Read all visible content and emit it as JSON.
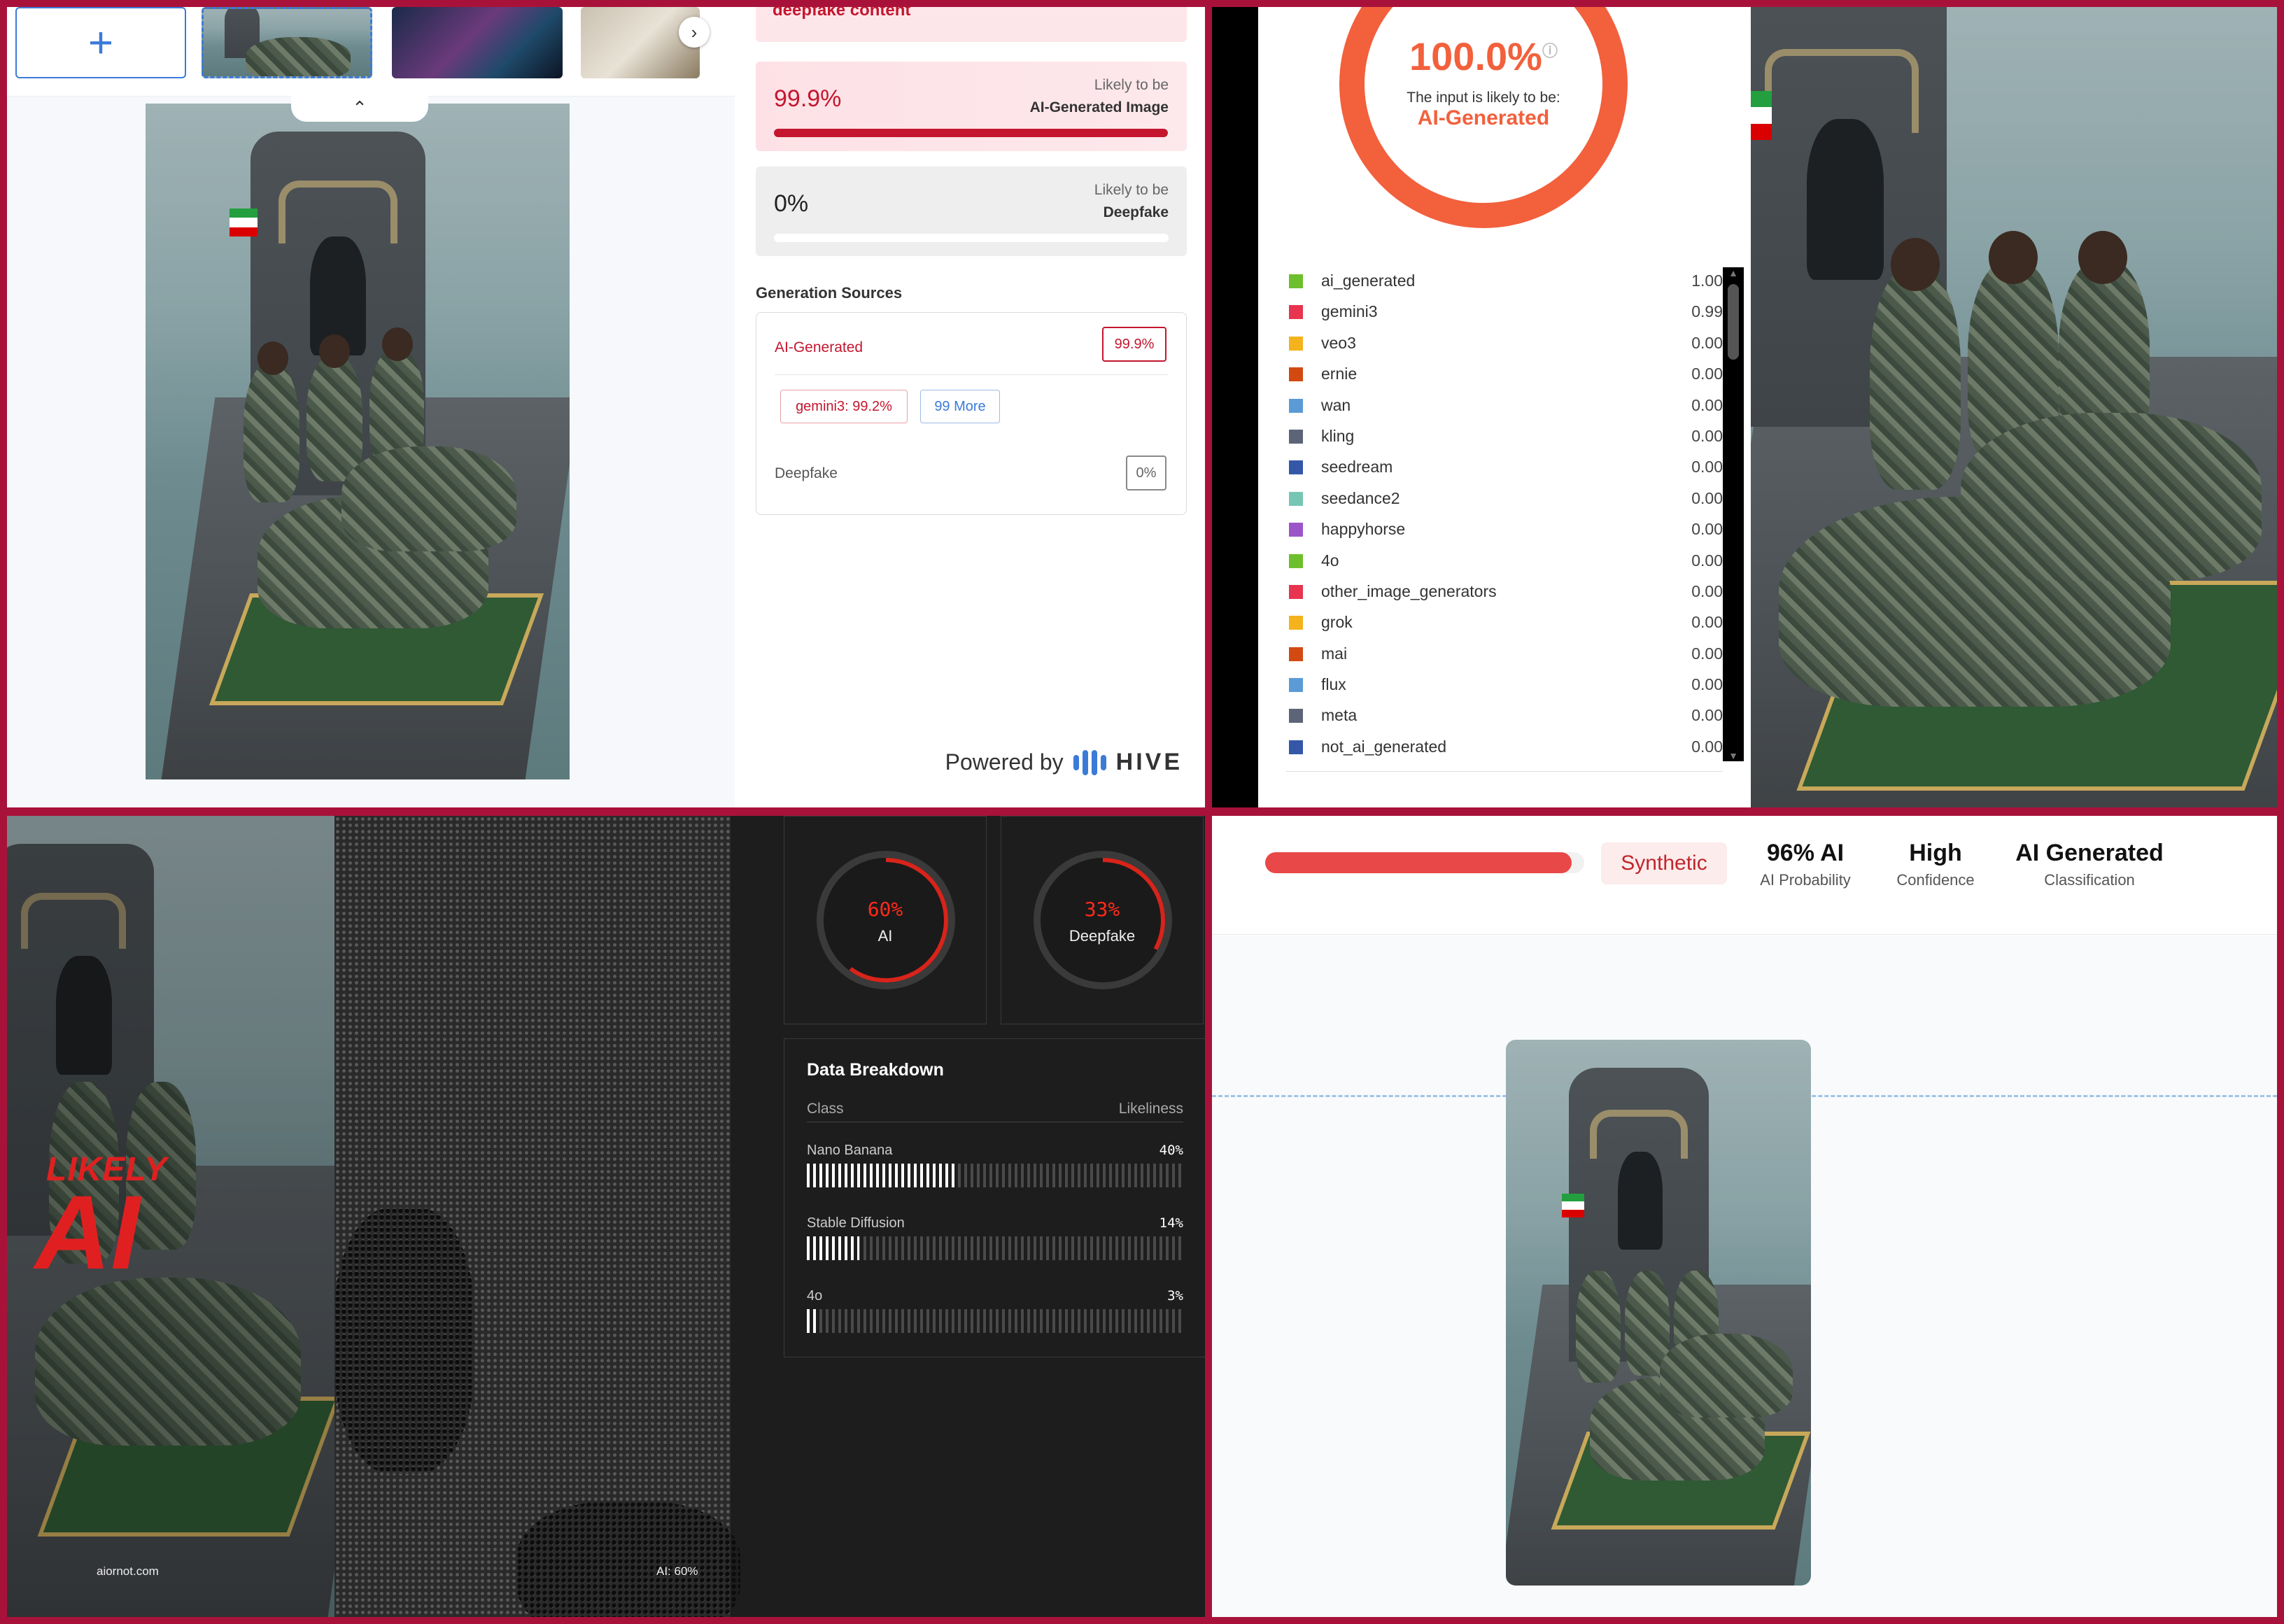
{
  "panel1": {
    "toolbar": {
      "add_icon": "plus-icon",
      "next_icon": "chevron-right-icon",
      "collapse_icon": "chevron-up-icon"
    },
    "top_strip": "deepfake content",
    "ai_card": {
      "value": "99.9%",
      "label1": "Likely to be",
      "label2": "AI-Generated Image",
      "fill": 0.999
    },
    "df_card": {
      "value": "0%",
      "label1": "Likely to be",
      "label2": "Deepfake",
      "fill": 0.0
    },
    "sources_title": "Generation Sources",
    "ai_generated_label": "AI-Generated",
    "ai_generated_value": "99.9%",
    "source_pill": "gemini3: 99.2%",
    "more_pill": "99 More",
    "deepfake_label": "Deepfake",
    "deepfake_value": "0%",
    "powered_by": "Powered by",
    "brand": "HIVE",
    "colors": {
      "accent": "#3b7bd8",
      "danger": "#c4162e"
    }
  },
  "panel2": {
    "donut": {
      "percent": "100.0%",
      "subtitle": "The input is likely to be:",
      "classification": "AI-Generated",
      "color": "#f2603c"
    },
    "legend": [
      {
        "name": "ai_generated",
        "score": "1.00",
        "color": "#6dbf2c"
      },
      {
        "name": "gemini3",
        "score": "0.99",
        "color": "#e8344f"
      },
      {
        "name": "veo3",
        "score": "0.00",
        "color": "#f4b31c"
      },
      {
        "name": "ernie",
        "score": "0.00",
        "color": "#d24a12"
      },
      {
        "name": "wan",
        "score": "0.00",
        "color": "#5b9bd5"
      },
      {
        "name": "kling",
        "score": "0.00",
        "color": "#5b6577"
      },
      {
        "name": "seedream",
        "score": "0.00",
        "color": "#3557a8"
      },
      {
        "name": "seedance2",
        "score": "0.00",
        "color": "#77c6b4"
      },
      {
        "name": "happyhorse",
        "score": "0.00",
        "color": "#9b55c9"
      },
      {
        "name": "4o",
        "score": "0.00",
        "color": "#6dbf2c"
      },
      {
        "name": "other_image_generators",
        "score": "0.00",
        "color": "#e8344f"
      },
      {
        "name": "grok",
        "score": "0.00",
        "color": "#f4b31c"
      },
      {
        "name": "mai",
        "score": "0.00",
        "color": "#d24a12"
      },
      {
        "name": "flux",
        "score": "0.00",
        "color": "#5b9bd5"
      },
      {
        "name": "meta",
        "score": "0.00",
        "color": "#5b6577"
      },
      {
        "name": "not_ai_generated",
        "score": "0.00",
        "color": "#3557a8"
      }
    ]
  },
  "panel3": {
    "likely": "LIKELY",
    "ai": "AI",
    "site": "aiornot.com",
    "ai_tag": "AI: 60%",
    "gauges": [
      {
        "value": "60%",
        "label": "AI",
        "fraction": 0.6
      },
      {
        "value": "33%",
        "label": "Deepfake",
        "fraction": 0.33
      }
    ],
    "breakdown": {
      "title": "Data Breakdown",
      "col_class": "Class",
      "col_likeliness": "Likeliness",
      "rows": [
        {
          "name": "Nano Banana",
          "pct": "40%",
          "fraction": 0.4
        },
        {
          "name": "Stable Diffusion",
          "pct": "14%",
          "fraction": 0.14
        },
        {
          "name": "4o",
          "pct": "3%",
          "fraction": 0.03
        }
      ]
    }
  },
  "panel4": {
    "bar_fill": 0.96,
    "badge": "Synthetic",
    "stats": [
      {
        "value": "96% AI",
        "label": "AI Probability"
      },
      {
        "value": "High",
        "label": "Confidence"
      },
      {
        "value": "AI Generated",
        "label": "Classification"
      }
    ]
  }
}
